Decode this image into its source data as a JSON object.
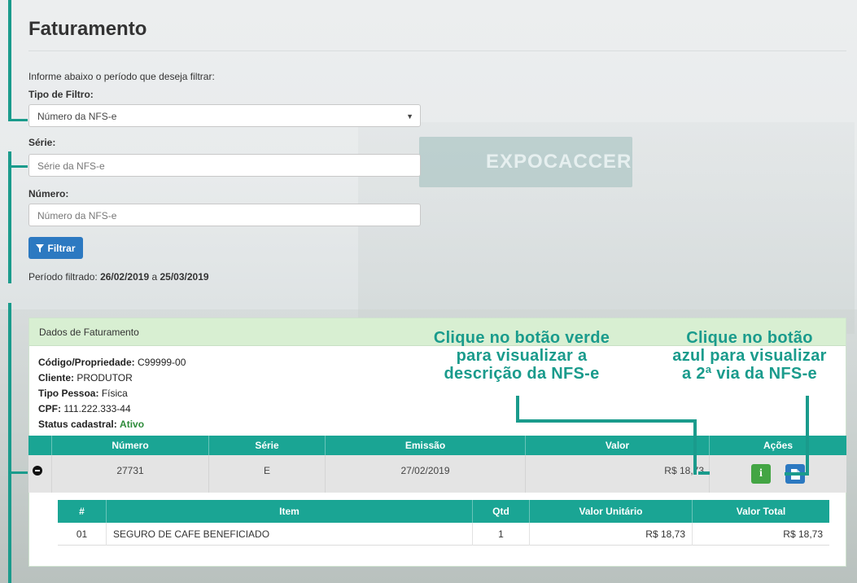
{
  "page": {
    "title": "Faturamento",
    "intro": "Informe abaixo o período que deseja filtrar:"
  },
  "background": {
    "sign_text": "EXPOCACCER"
  },
  "filter": {
    "tipo_label": "Tipo de Filtro:",
    "tipo_value": "Número da NFS-e",
    "serie_label": "Série:",
    "serie_placeholder": "Série da NFS-e",
    "numero_label": "Número:",
    "numero_placeholder": "Número da NFS-e",
    "button_label": "Filtrar",
    "period_prefix": "Período filtrado:",
    "period_start": "26/02/2019",
    "period_sep": "a",
    "period_end": "25/03/2019"
  },
  "panel": {
    "heading": "Dados de Faturamento",
    "codigo_label": "Código/Propriedade:",
    "codigo_value": "C99999-00",
    "cliente_label": "Cliente:",
    "cliente_value": "PRODUTOR",
    "tipo_pessoa_label": "Tipo Pessoa:",
    "tipo_pessoa_value": "Física",
    "cpf_label": "CPF:",
    "cpf_value": "111.222.333-44",
    "status_label": "Status cadastral:",
    "status_value": "Ativo"
  },
  "table": {
    "headers": [
      "Número",
      "Série",
      "Emissão",
      "Valor",
      "Ações"
    ],
    "row": {
      "numero": "27731",
      "serie": "E",
      "emissao": "27/02/2019",
      "valor": "R$ 18,73"
    }
  },
  "subtable": {
    "headers": [
      "#",
      "Item",
      "Qtd",
      "Valor Unitário",
      "Valor Total"
    ],
    "row": {
      "num": "01",
      "item": "SEGURO DE CAFE BENEFICIADO",
      "qtd": "1",
      "valor_unitario": "R$ 18,73",
      "valor_total": "R$ 18,73"
    }
  },
  "callouts": {
    "green": [
      "Clique no botão verde",
      "para visualizar a",
      "descrição da NFS-e"
    ],
    "blue": [
      "Clique no botão",
      "azul para visualizar",
      "a 2ª via da NFS-e"
    ]
  },
  "colors": {
    "accent": "#1a9b8c",
    "table_header": "#1aa594",
    "primary": "#2c79c1",
    "success": "#43a544",
    "panel_head": "#d8efd2"
  },
  "icons": {
    "filter": "funnel-icon",
    "info": "info-icon",
    "document": "document-icon",
    "collapse": "minus-circle-icon",
    "dropdown": "caret-down-icon"
  }
}
